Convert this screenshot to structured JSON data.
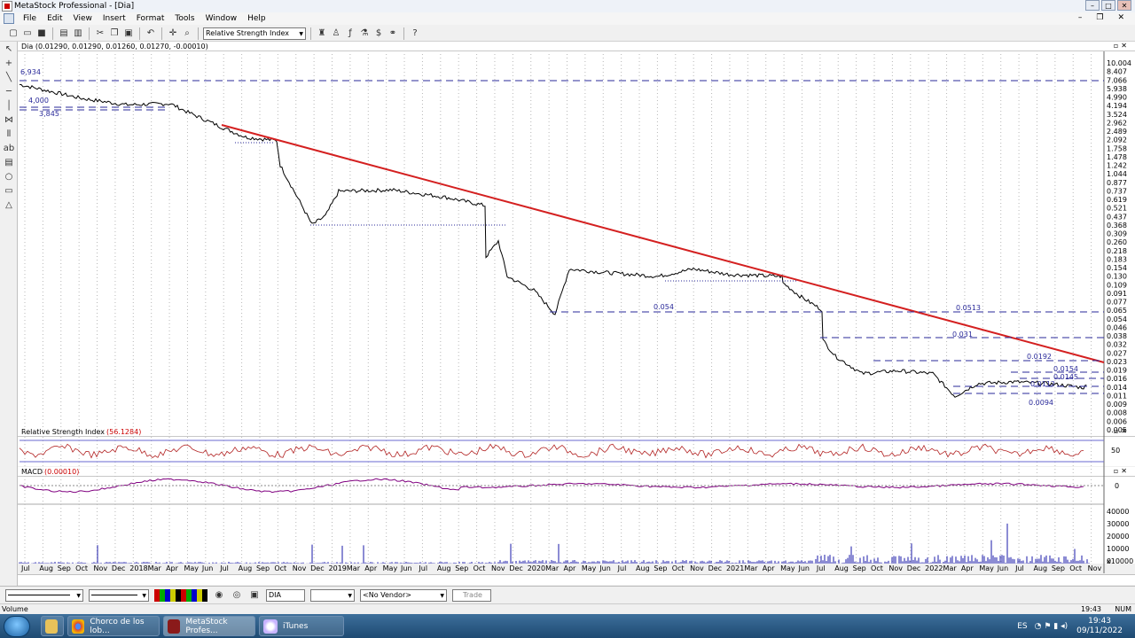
{
  "window": {
    "title": "MetaStock Professional - [Dia]",
    "min": "–",
    "max": "□",
    "close": "✕"
  },
  "menu": [
    "File",
    "Edit",
    "View",
    "Insert",
    "Format",
    "Tools",
    "Window",
    "Help"
  ],
  "mdi": {
    "min": "–",
    "restore": "❐",
    "close": "✕"
  },
  "toolbar": {
    "indicator_select": "Relative Strength Index"
  },
  "price_panel": {
    "header": "Dia (0.01290, 0.01290, 0.01260, 0.01270, -0.00010)",
    "labels": [
      "6,934",
      "4,000",
      "3,845",
      "0.054",
      "0.0513",
      "0.031",
      "0.0192",
      "0.0154",
      "0.0145",
      "0.0112",
      "0.0094"
    ],
    "y_ticks": [
      "10.004",
      "8.407",
      "7.066",
      "5.938",
      "4.990",
      "4.194",
      "3.524",
      "2.962",
      "2.489",
      "2.092",
      "1.758",
      "1.478",
      "1.242",
      "1.044",
      "0.877",
      "0.737",
      "0.619",
      "0.521",
      "0.437",
      "0.368",
      "0.309",
      "0.260",
      "0.218",
      "0.183",
      "0.154",
      "0.130",
      "0.109",
      "0.091",
      "0.077",
      "0.065",
      "0.054",
      "0.046",
      "0.038",
      "0.032",
      "0.027",
      "0.023",
      "0.019",
      "0.016",
      "0.014",
      "0.011",
      "0.009",
      "0.008",
      "0.006",
      "0.005"
    ]
  },
  "rsi_panel": {
    "name": "Relative Strength Index",
    "value": "(56.1284)",
    "y_tick": "50"
  },
  "macd_panel": {
    "name": "MACD",
    "value": "(0.00010)",
    "y_tick": "0"
  },
  "volume_panel": {
    "y_ticks": [
      "40000",
      "30000",
      "20000",
      "10000",
      "0"
    ],
    "multiplier": "x10000"
  },
  "x_axis": [
    "Jul",
    "Aug",
    "Sep",
    "Oct",
    "Nov",
    "Dec",
    "2018",
    "Mar",
    "Apr",
    "May",
    "Jun",
    "Jul",
    "Aug",
    "Sep",
    "Oct",
    "Nov",
    "Dec",
    "2019",
    "Mar",
    "Apr",
    "May",
    "Jun",
    "Jul",
    "Aug",
    "Sep",
    "Oct",
    "Nov",
    "Dec",
    "2020",
    "Mar",
    "Apr",
    "May",
    "Jun",
    "Jul",
    "Aug",
    "Sep",
    "Oct",
    "Nov",
    "Dec",
    "2021",
    "Mar",
    "Apr",
    "May",
    "Jun",
    "Jul",
    "Aug",
    "Sep",
    "Oct",
    "Nov",
    "Dec",
    "2022",
    "Mar",
    "Apr",
    "May",
    "Jun",
    "Jul",
    "Aug",
    "Sep",
    "Oct",
    "Nov"
  ],
  "bottom_bar": {
    "symbol": "DIA",
    "vendor": "<No Vendor>",
    "trade": "Trade"
  },
  "status": {
    "left": "Volume",
    "time": "19:43",
    "caps": "NUM"
  },
  "taskbar": {
    "items": [
      "Chorco de los lob...",
      "MetaStock Profes...",
      "iTunes"
    ],
    "clock_time": "19:43",
    "clock_date": "09/11/2022",
    "lang": "ES"
  },
  "colors": {
    "trendline": "#d42020",
    "price": "#000000",
    "rsi": "#b22222",
    "macd": "#800080",
    "volume": "#1a1aa8",
    "support": "#2a2a9a"
  }
}
